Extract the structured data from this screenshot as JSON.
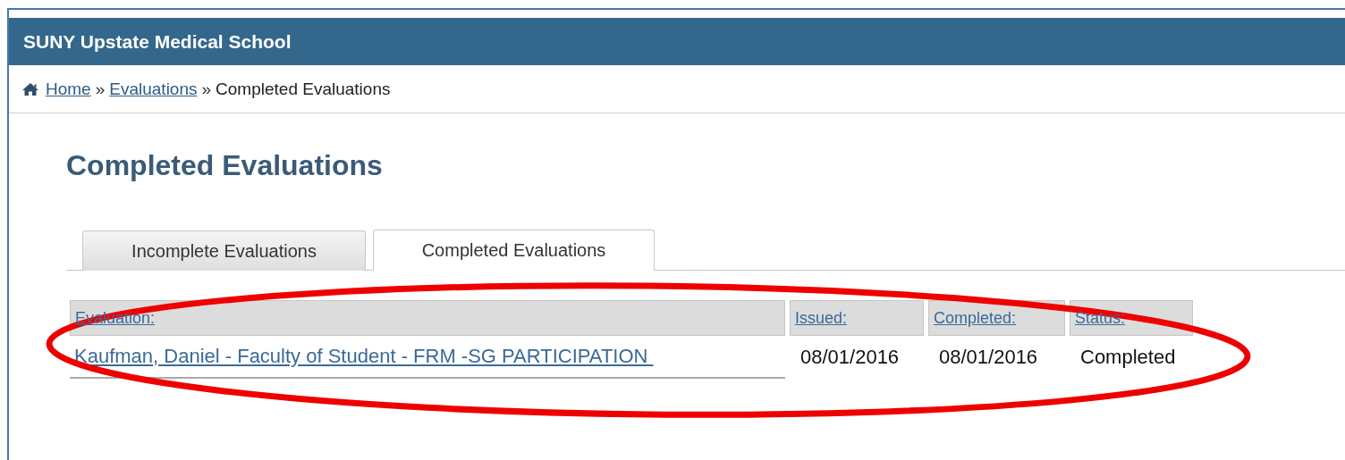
{
  "header": {
    "title": "SUNY Upstate Medical School"
  },
  "breadcrumb": {
    "links": [
      "Home",
      "Evaluations"
    ],
    "separator": "»",
    "current": "Completed Evaluations"
  },
  "page_title": "Completed Evaluations",
  "tabs": [
    {
      "label": "Incomplete Evaluations",
      "selected": false
    },
    {
      "label": "Completed Evaluations",
      "selected": true
    }
  ],
  "table": {
    "columns": [
      "Evaluation:",
      "Issued:",
      "Completed:",
      "Status:"
    ],
    "rows": [
      {
        "evaluation": "Kaufman, Daniel - Faculty of Student - FRM -SG PARTICIPATION ",
        "issued": "08/01/2016",
        "completed": "08/01/2016",
        "status": "Completed"
      }
    ]
  }
}
